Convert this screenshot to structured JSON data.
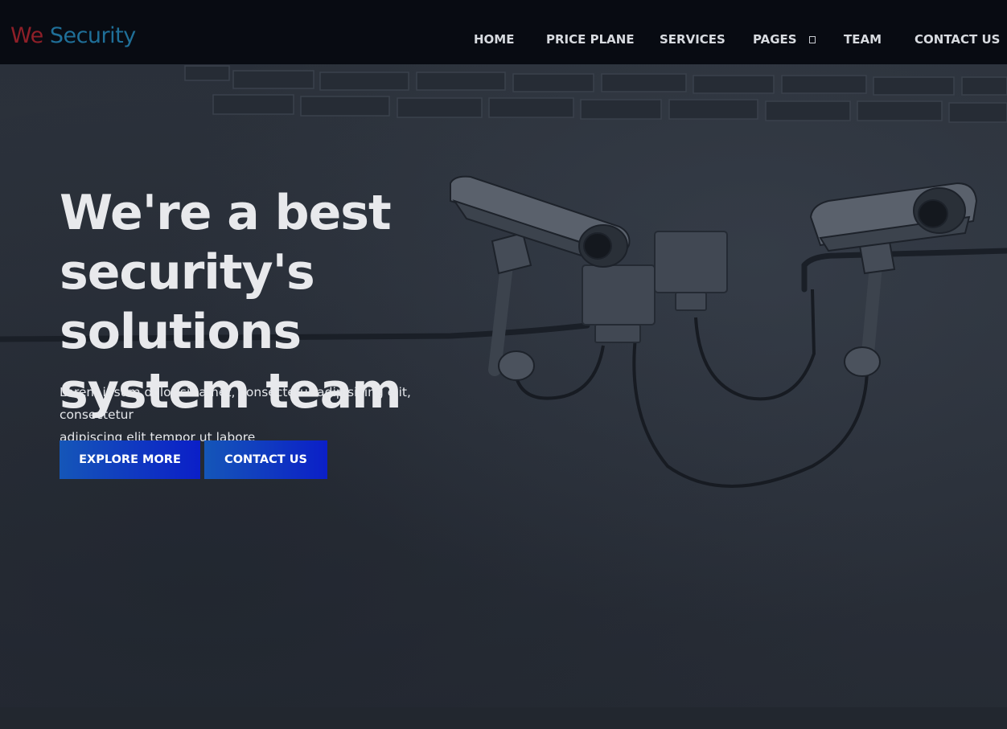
{
  "brand": {
    "part1": "We",
    "part2": "Security"
  },
  "nav": {
    "home": "HOME",
    "price_plane": "PRICE PLANE",
    "services": "SERVICES",
    "pages": "PAGES",
    "team": "TEAM",
    "contact": "CONTACT US"
  },
  "hero": {
    "title_line1": "We're a best",
    "title_line2": "security's solutions",
    "title_line3": "system team",
    "description_line1": "Lorem ipsum dolor sit amet, consectetur adipisicing elit, consectetur",
    "description_line2": "adipiscing elit tempor ut labore",
    "explore_label": "EXPLORE MORE",
    "contact_label": "CONTACT US"
  },
  "colors": {
    "navbar_bg": "#080b12",
    "brand_we": "#8e1f28",
    "brand_security": "#1f6f98",
    "button_gradient_start": "#1556b8",
    "button_gradient_end": "#0b1fc8",
    "wall": "#2b313b"
  },
  "icons": {
    "pages_dropdown": "dropdown-caret-icon"
  }
}
